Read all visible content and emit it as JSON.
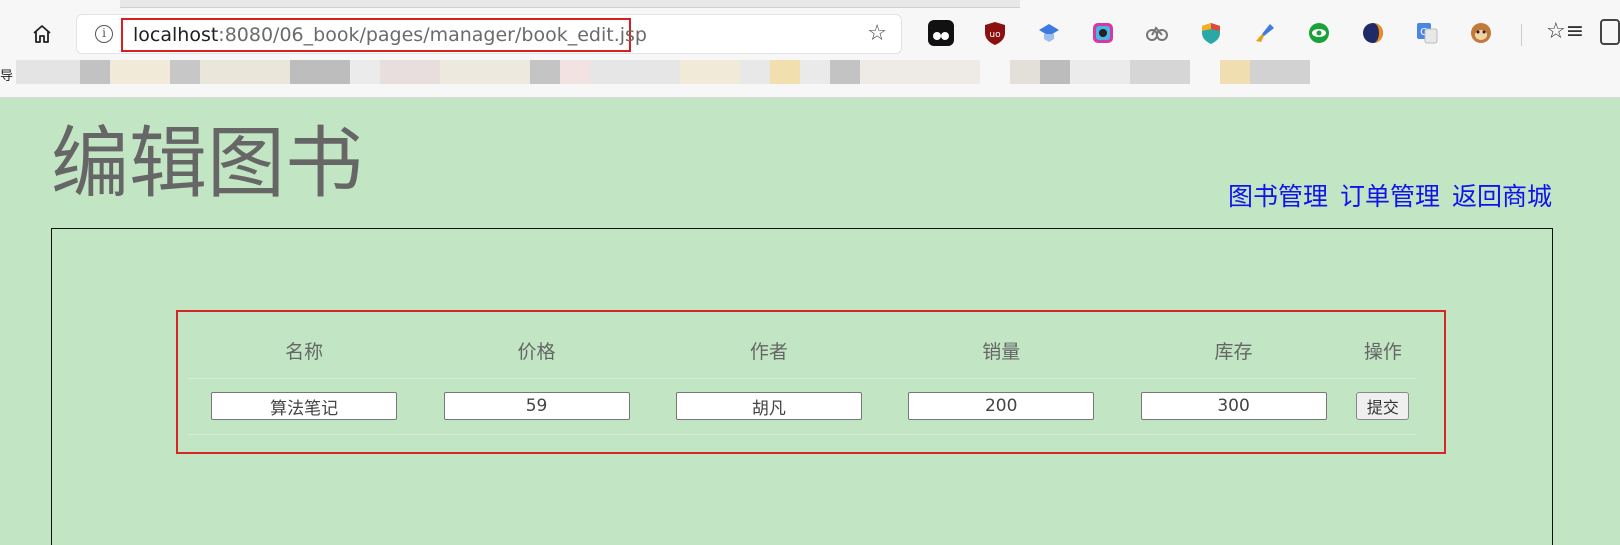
{
  "browser": {
    "url_host": "localhost",
    "url_rest": ":8080/06_book/pages/manager/book_edit.jsp",
    "bookmark_label": "导",
    "icons": [
      "home-icon",
      "info-icon",
      "star-icon"
    ],
    "extensions": [
      {
        "name": "tampermonkey-icon",
        "color": "#111111"
      },
      {
        "name": "ublock-icon",
        "color": "#8b1010"
      },
      {
        "name": "extension-blue-icon",
        "color": "#3d7be0"
      },
      {
        "name": "extension-camera-icon",
        "color": "#d23aa0"
      },
      {
        "name": "extension-bike-icon",
        "color": "#777777"
      },
      {
        "name": "extension-shield-icon",
        "color": "#e0483a"
      },
      {
        "name": "extension-brush-icon",
        "color": "#e0a020"
      },
      {
        "name": "extension-eye-icon",
        "color": "#1aa23a"
      },
      {
        "name": "extension-moon-icon",
        "color": "#1e2b66"
      },
      {
        "name": "translate-icon",
        "color": "#4a86e8"
      },
      {
        "name": "extension-monkey-icon",
        "color": "#c27a3a"
      }
    ]
  },
  "page": {
    "title": "编辑图书",
    "nav": [
      "图书管理",
      "订单管理",
      "返回商城"
    ]
  },
  "form": {
    "headers": [
      "名称",
      "价格",
      "作者",
      "销量",
      "库存",
      "操作"
    ],
    "values": {
      "name": "算法笔记",
      "price": "59",
      "author": "胡凡",
      "sales": "200",
      "stock": "300"
    },
    "submit_label": "提交"
  },
  "colors": {
    "background": "#c2e5c4",
    "highlight_border": "#d62727",
    "link": "#1212ee",
    "title": "#666666"
  }
}
